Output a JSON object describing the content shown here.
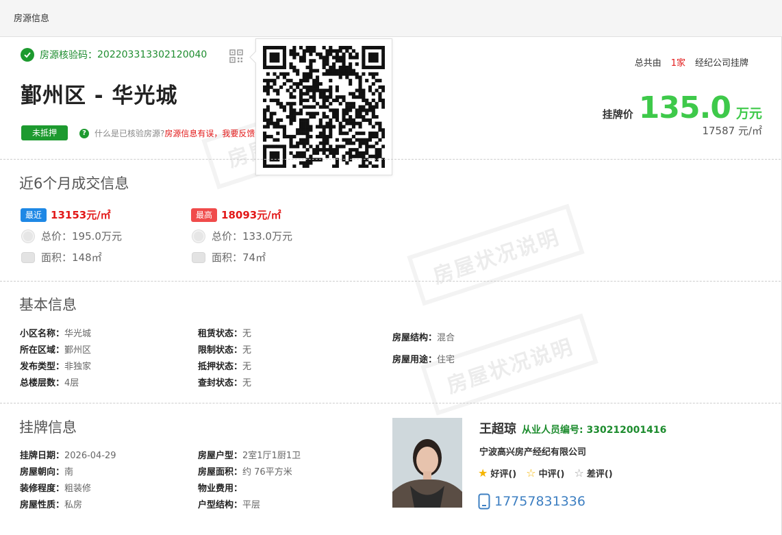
{
  "topbar": {
    "title": "房源信息"
  },
  "verification": {
    "label": "房源核验码：",
    "code": "202203313302120040"
  },
  "listing": {
    "title": "鄞州区 - 华光城",
    "pledge_badge": "未抵押",
    "help_question": "什么是已核验房源?",
    "help_report": "房源信息有误，我要反馈>"
  },
  "agencies": {
    "prefix": "总共由",
    "count": "1家",
    "suffix": "经纪公司挂牌"
  },
  "price": {
    "label": "挂牌价",
    "value": "135.0",
    "unit": "万元",
    "unit_price": "17587 元/㎡"
  },
  "watermark": {
    "text": "房屋状况说明"
  },
  "deals": {
    "title": "近6个月成交信息",
    "recent": {
      "tag": "最近",
      "unit_price": "13153元/㎡",
      "total": "总价：195.0万元",
      "area": "面积：148㎡"
    },
    "highest": {
      "tag": "最高",
      "unit_price": "18093元/㎡",
      "total": "总价：133.0万元",
      "area": "面积：74㎡"
    },
    "colors": {
      "recent": "#1e88e5",
      "highest": "#f04b4b"
    }
  },
  "basic": {
    "title": "基本信息",
    "col1": [
      {
        "k": "小区名称：",
        "v": "华光城"
      },
      {
        "k": "所在区域：",
        "v": "鄞州区"
      },
      {
        "k": "发布类型：",
        "v": "非独家"
      },
      {
        "k": "总楼层数：",
        "v": "4层"
      }
    ],
    "col2": [
      {
        "k": "租赁状态：",
        "v": "无"
      },
      {
        "k": "限制状态：",
        "v": "无"
      },
      {
        "k": "抵押状态：",
        "v": "无"
      },
      {
        "k": "查封状态：",
        "v": "无"
      }
    ],
    "col3": [
      {
        "k": "房屋结构：",
        "v": "混合"
      },
      {
        "k": "房屋用途：",
        "v": "住宅"
      }
    ]
  },
  "listing_info": {
    "title": "挂牌信息",
    "col1": [
      {
        "k": "挂牌日期：",
        "v": "2026-04-29"
      },
      {
        "k": "房屋朝向：",
        "v": "南"
      },
      {
        "k": "装修程度：",
        "v": "粗装修"
      },
      {
        "k": "房屋性质：",
        "v": "私房"
      }
    ],
    "col2": [
      {
        "k": "房屋户型：",
        "v": "2室1厅1厨1卫"
      },
      {
        "k": "房屋面积：",
        "v": "约 76平方米"
      },
      {
        "k": "物业费用：",
        "v": ""
      },
      {
        "k": "户型结构：",
        "v": "平层"
      }
    ]
  },
  "agent": {
    "name": "王超琼",
    "id_label": "从业人员编号: 330212001416",
    "company": "宁波高兴房产经纪有限公司",
    "ratings": {
      "good": "好评()",
      "medium": "中评()",
      "bad": "差评()"
    },
    "phone": "17757831336"
  },
  "icons": [
    "check-icon",
    "qr-code-icon",
    "help-icon",
    "coin-icon",
    "area-icon",
    "star-filled-icon",
    "star-outline-icon",
    "phone-icon"
  ],
  "colors": {
    "green": "#1d9a2f",
    "price_green": "#3ec94a",
    "red": "#e21818",
    "blue": "#3d7fc2"
  }
}
